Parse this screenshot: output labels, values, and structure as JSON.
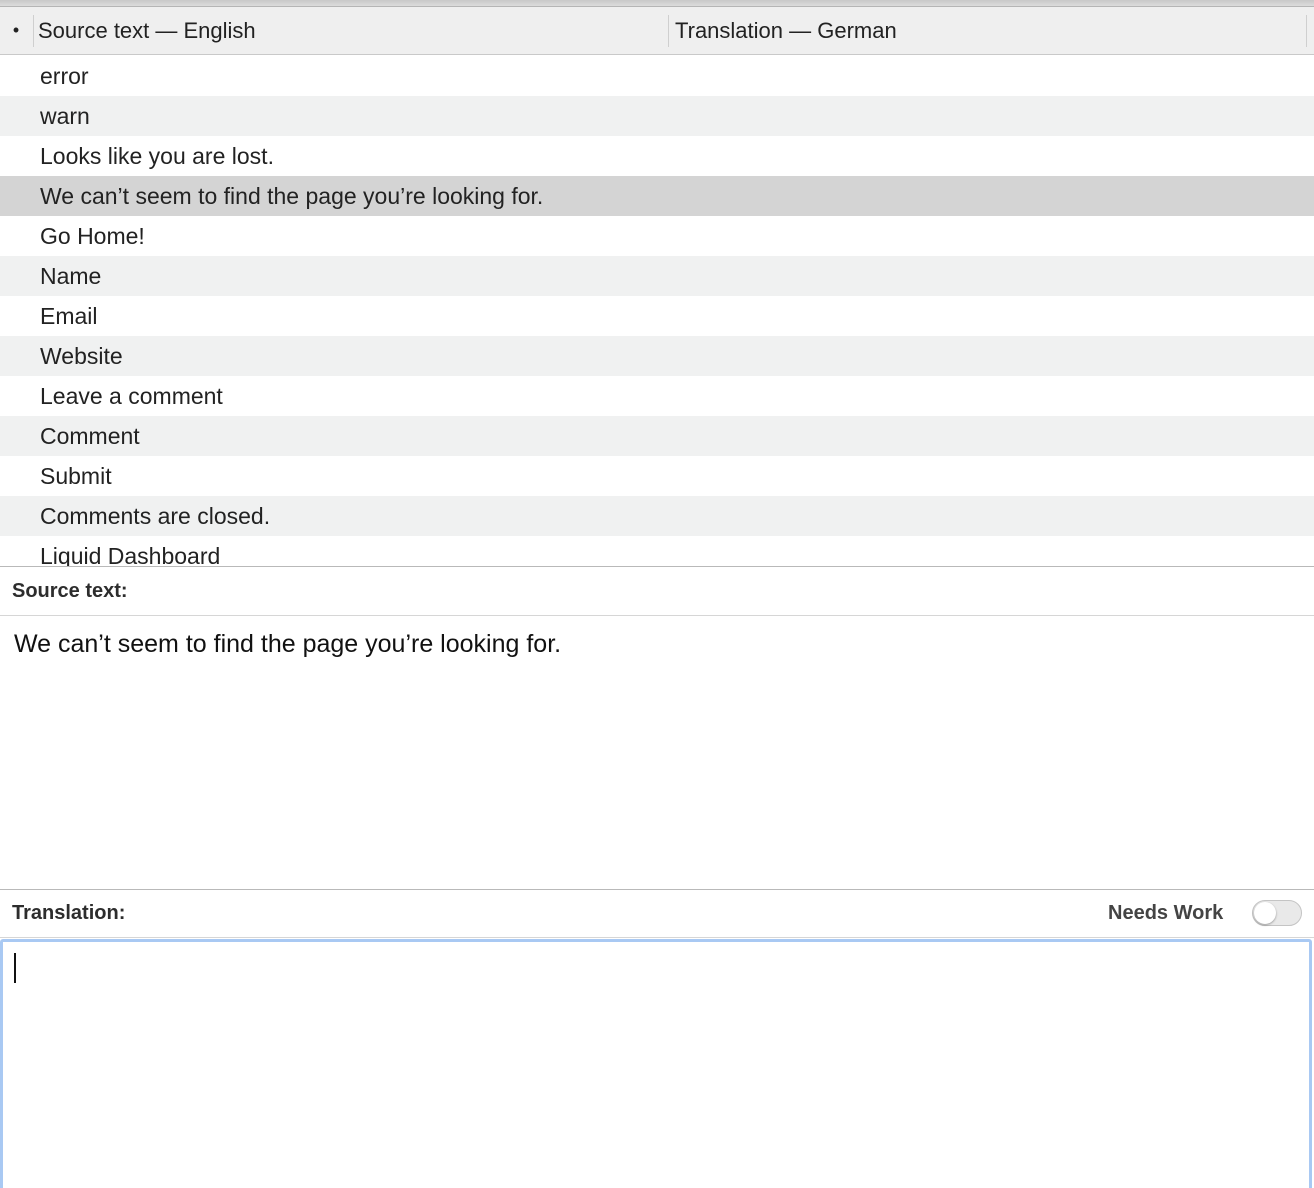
{
  "table": {
    "bullet": "•",
    "source_header": "Source text — English",
    "translation_header": "Translation — German",
    "rows": [
      {
        "source": "error",
        "translation": ""
      },
      {
        "source": "warn",
        "translation": ""
      },
      {
        "source": "Looks like you are lost.",
        "translation": ""
      },
      {
        "source": "We can’t seem to find the page you’re looking for.",
        "translation": ""
      },
      {
        "source": "Go Home!",
        "translation": ""
      },
      {
        "source": "Name",
        "translation": ""
      },
      {
        "source": "Email",
        "translation": ""
      },
      {
        "source": "Website",
        "translation": ""
      },
      {
        "source": "Leave a comment",
        "translation": ""
      },
      {
        "source": "Comment",
        "translation": ""
      },
      {
        "source": "Submit",
        "translation": ""
      },
      {
        "source": "Comments are closed.",
        "translation": ""
      },
      {
        "source": "Liquid Dashboard",
        "translation": ""
      }
    ],
    "selected_index": 3
  },
  "source_panel": {
    "label": "Source text:",
    "text": "We can’t seem to find the page you’re looking for."
  },
  "translation_panel": {
    "label": "Translation:",
    "needs_work_label": "Needs Work",
    "needs_work_on": false,
    "value": ""
  },
  "colors": {
    "row_alt": "#f0f1f1",
    "row_selected": "#d4d4d4",
    "focus_ring": "#a9c9f3"
  }
}
